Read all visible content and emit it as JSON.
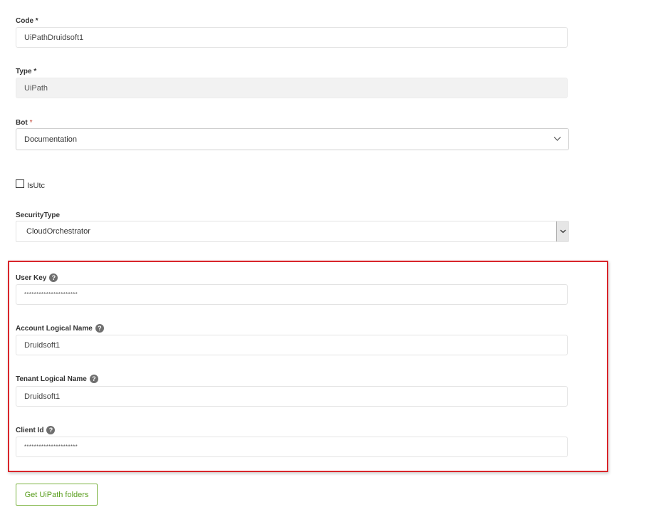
{
  "fields": {
    "code": {
      "label": "Code",
      "required_mark": "*",
      "value": "UiPathDruidsoft1"
    },
    "type": {
      "label": "Type",
      "required_mark": "*",
      "value": "UiPath"
    },
    "bot": {
      "label": "Bot",
      "required_mark": "*",
      "value": "Documentation"
    },
    "is_utc": {
      "label": "IsUtc",
      "checked": false
    },
    "security_type": {
      "label": "SecurityType",
      "value": "CloudOrchestrator"
    },
    "user_key": {
      "label": "User Key",
      "value": "**********************"
    },
    "account_logical_name": {
      "label": "Account Logical Name",
      "value": "Druidsoft1"
    },
    "tenant_logical_name": {
      "label": "Tenant Logical Name",
      "value": "Druidsoft1"
    },
    "client_id": {
      "label": "Client Id",
      "value": "**********************"
    }
  },
  "help_glyph": "?",
  "icons": {
    "help": "question-circle-icon",
    "dropdown": "chevron-down-icon"
  },
  "colors": {
    "highlight_border": "#d9252a",
    "button_border": "#7cb342",
    "button_text": "#5a9e1e",
    "required": "#c0392b"
  },
  "actions": {
    "get_folders_label": "Get UiPath folders"
  }
}
